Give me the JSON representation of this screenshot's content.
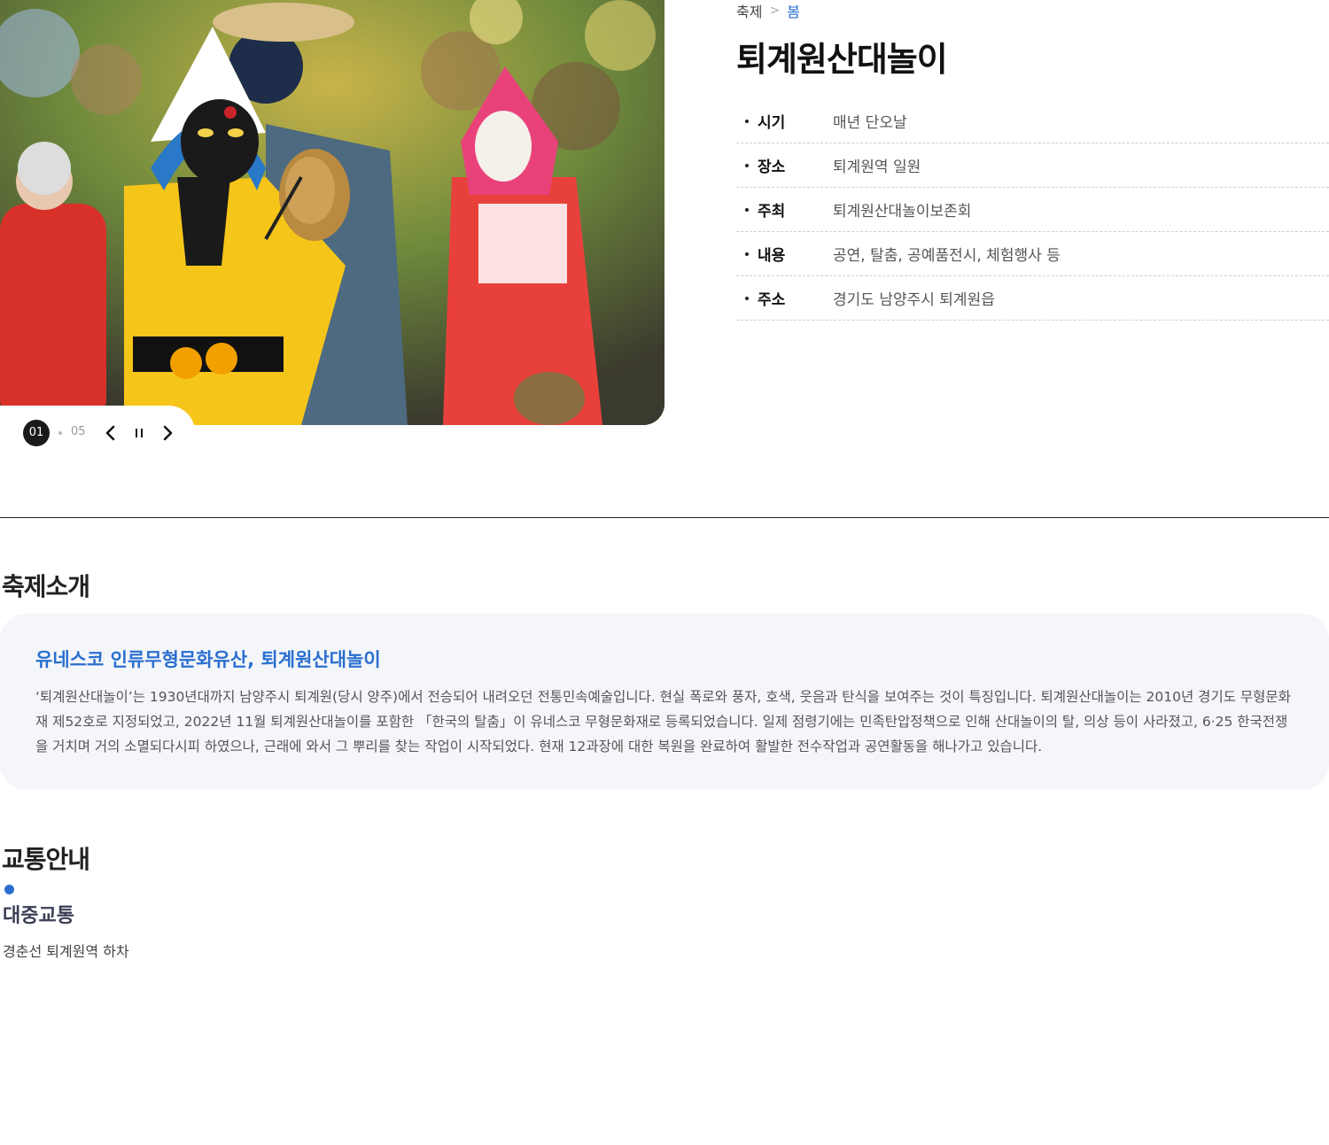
{
  "hero": {
    "slide_current": "01",
    "slide_total": "05",
    "icons": {
      "prev": "chevron-left-icon",
      "pause": "pause-icon",
      "next": "chevron-right-icon"
    }
  },
  "breadcrumb": {
    "parent": "축제",
    "current": "봄"
  },
  "title": "퇴계원산대놀이",
  "info": [
    {
      "label": "시기",
      "value": "매년 단오날"
    },
    {
      "label": "장소",
      "value": "퇴계원역 일원"
    },
    {
      "label": "주최",
      "value": "퇴계원산대놀이보존회"
    },
    {
      "label": "내용",
      "value": "공연, 탈춤, 공예품전시, 체험행사 등"
    },
    {
      "label": "주소",
      "value": "경기도 남양주시 퇴계원읍"
    }
  ],
  "intro": {
    "section_title": "축제소개",
    "heading": "유네스코 인류무형문화유산, 퇴계원산대놀이",
    "body": "‘퇴계원산대놀이’는 1930년대까지 남양주시 퇴계원(당시 양주)에서 전승되어 내려오던 전통민속예술입니다. 현실 폭로와 풍자, 호색, 웃음과 탄식을 보여주는 것이 특징입니다. 퇴계원산대놀이는 2010년 경기도 무형문화재 제52호로 지정되었고, 2022년 11월 퇴계원산대놀이를 포함한 「한국의 탈춤」이 유네스코 무형문화재로 등록되었습니다. 일제 점령기에는 민족탄압정책으로 인해 산대놀이의 탈, 의상 등이 사라졌고, 6·25 한국전쟁을 거치며 거의 소멸되다시피 하였으나, 근래에 와서 그 뿌리를 찾는 작업이 시작되었다. 현재 12과장에 대한 복원을 완료하여 활발한 전수작업과 공연활동을 해나가고 있습니다."
  },
  "transport": {
    "section_title": "교통안내",
    "subtitle": "대중교통",
    "text": "경춘선 퇴계원역 하차"
  },
  "colors": {
    "accent": "#2a6fd0",
    "box_bg": "#f4f6fa"
  }
}
